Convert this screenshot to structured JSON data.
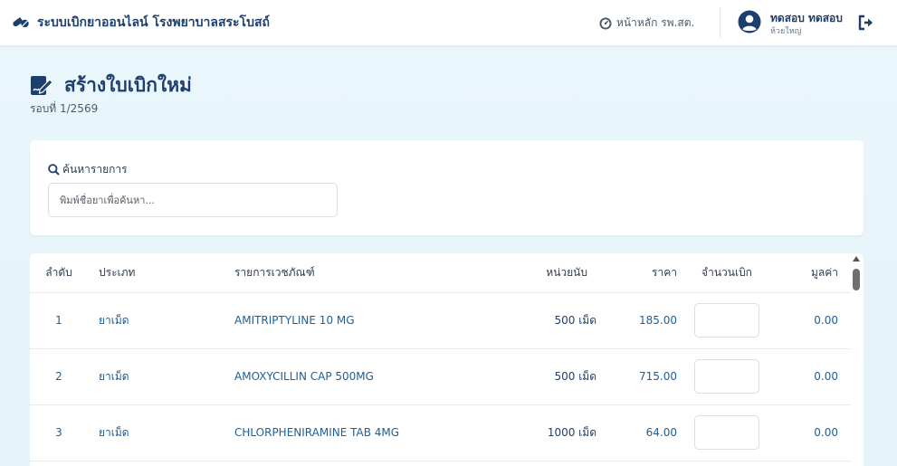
{
  "app": {
    "title": "ระบบเบิกยาออนไลน์  โรงพยาบาลสระโบสถ์"
  },
  "nav": {
    "home_label": "หน้าหลัก รพ.สต."
  },
  "user": {
    "name": "ทดสอบ ทดสอบ",
    "location": "ห้วยใหญ่"
  },
  "page": {
    "title": "สร้างใบเบิกใหม่",
    "subtitle": "รอบที่ 1/2569"
  },
  "search": {
    "label": "ค้นหารายการ",
    "placeholder": "พิมพ์ชื่อยาเพื่อค้นหา...",
    "value": ""
  },
  "table": {
    "columns": [
      "ลำดับ",
      "ประเภท",
      "รายการเวชภัณฑ์",
      "หน่วยนับ",
      "ราคา",
      "จำนวนเบิก",
      "มูลค่า"
    ],
    "rows": [
      {
        "no": "1",
        "type": "ยาเม็ด",
        "item": "AMITRIPTYLINE 10 MG",
        "unit": "500 เม็ด",
        "price": "185.00",
        "qty": "",
        "value": "0.00"
      },
      {
        "no": "2",
        "type": "ยาเม็ด",
        "item": "AMOXYCILLIN CAP 500MG",
        "unit": "500 เม็ด",
        "price": "715.00",
        "qty": "",
        "value": "0.00"
      },
      {
        "no": "3",
        "type": "ยาเม็ด",
        "item": "CHLORPHENIRAMINE TAB 4MG",
        "unit": "1000 เม็ด",
        "price": "64.00",
        "qty": "",
        "value": "0.00"
      }
    ]
  },
  "icons": {
    "brand": "pills-icon",
    "home": "dashboard-gauge-icon",
    "avatar": "user-circle-icon",
    "logout": "sign-out-icon",
    "page": "file-signature-icon",
    "search": "search-icon"
  },
  "colors": {
    "primary": "#1d3f6e",
    "link": "#1d5f99",
    "background": "#e8f5fb"
  }
}
